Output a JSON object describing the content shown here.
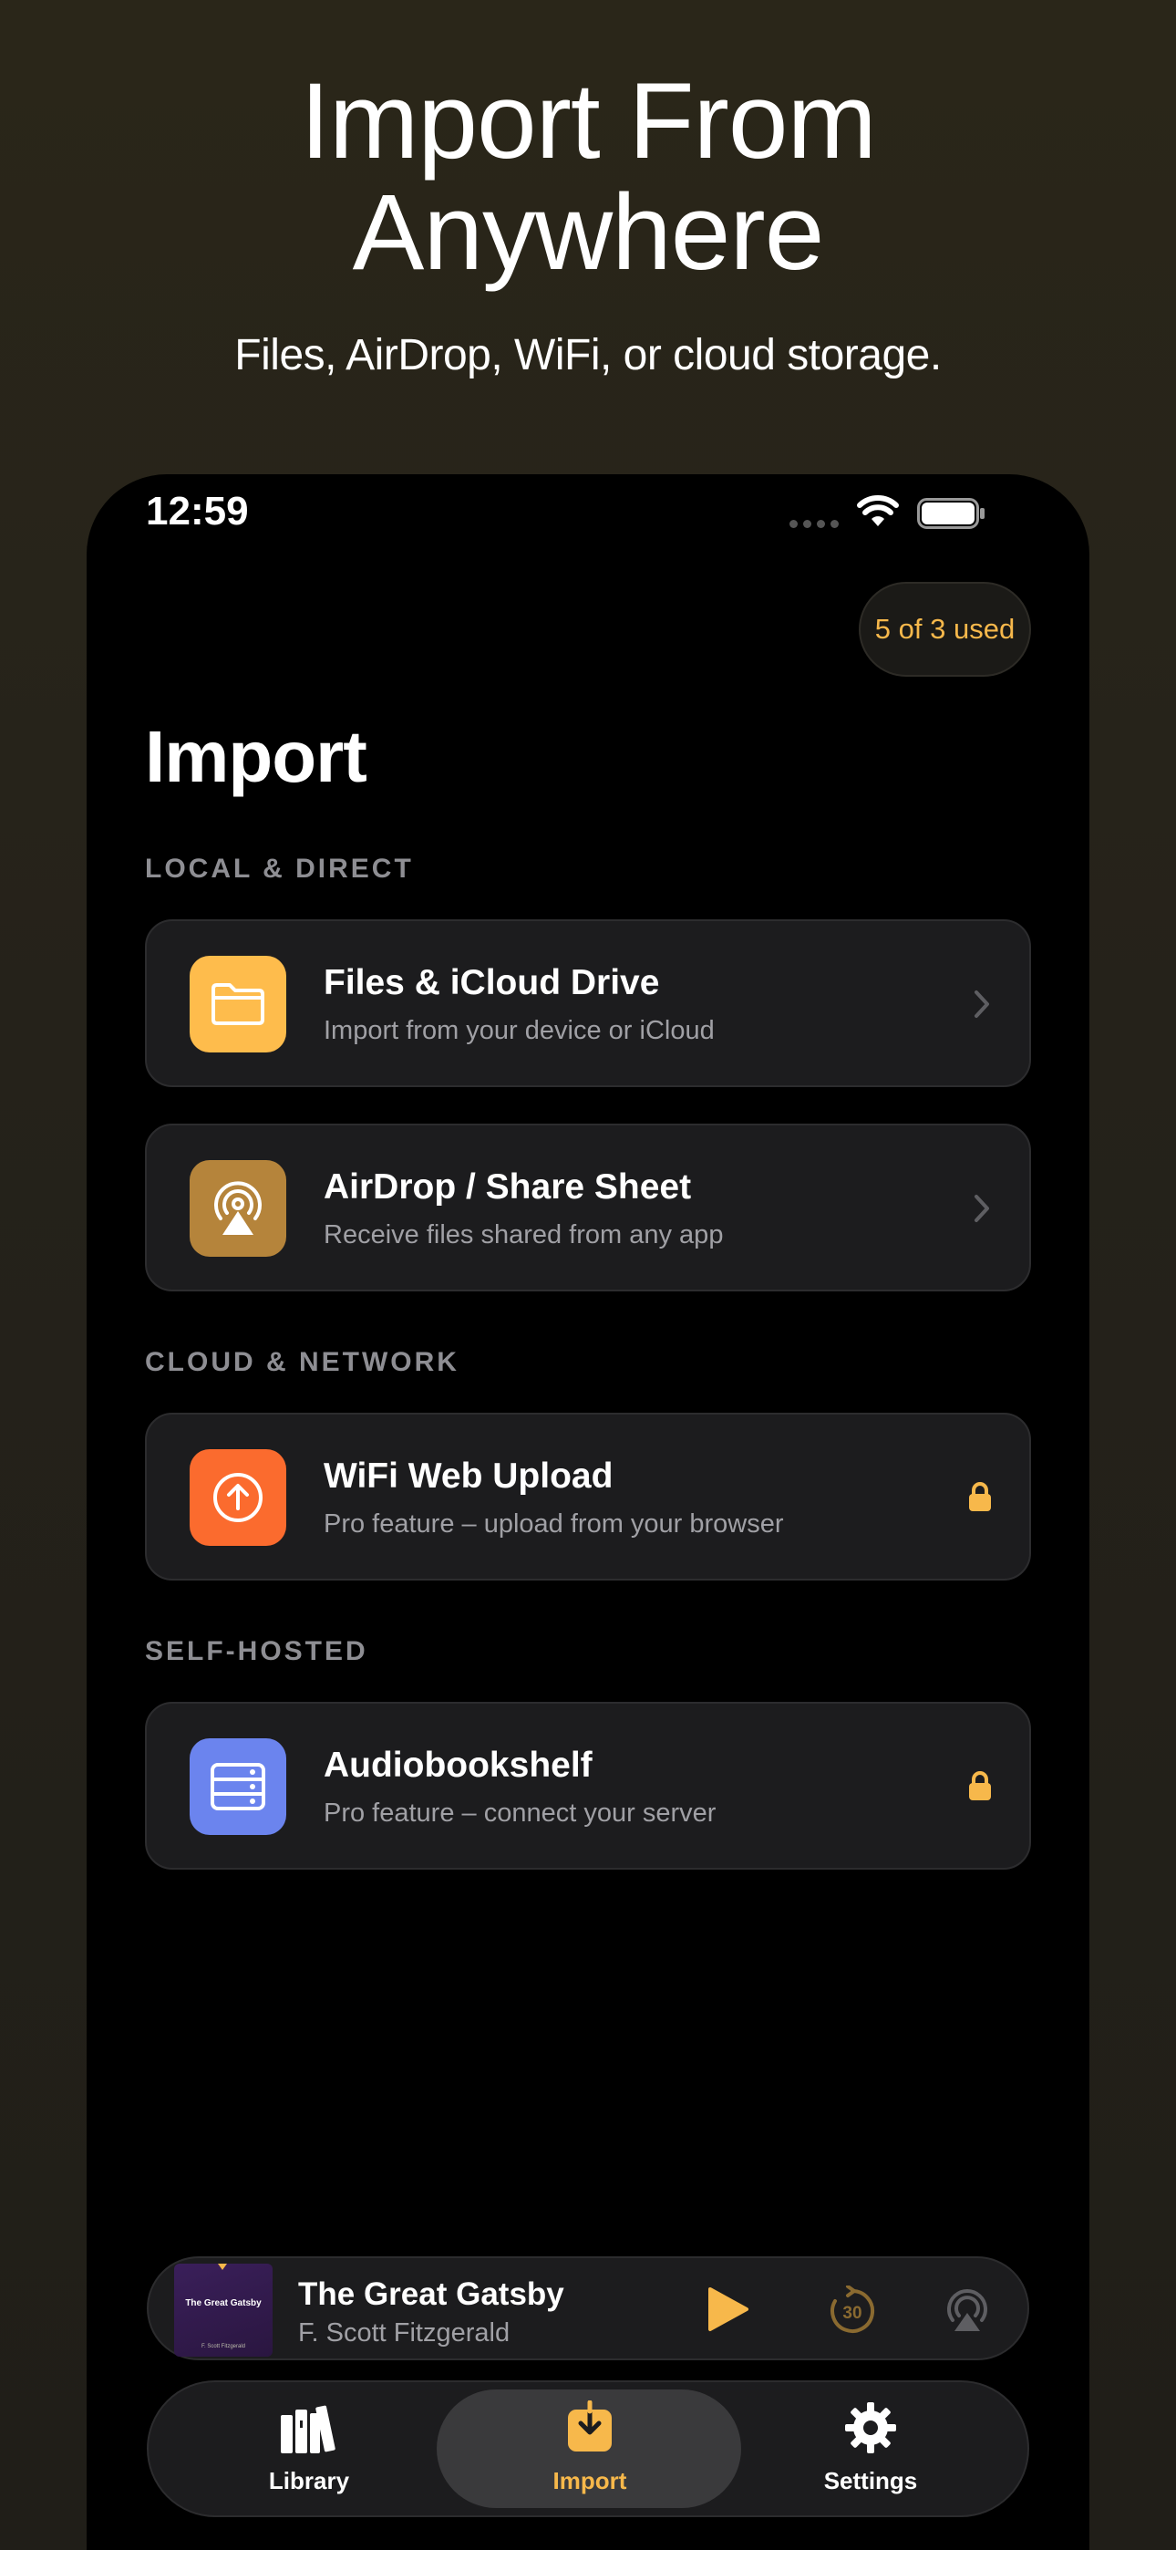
{
  "hero": {
    "title_line1": "Import From",
    "title_line2": "Anywhere",
    "subtitle": "Files, AirDrop, WiFi, or cloud storage."
  },
  "status_bar": {
    "time": "12:59"
  },
  "usage_badge": "5 of 3 used",
  "page_title": "Import",
  "sections": {
    "local": "LOCAL & DIRECT",
    "cloud": "CLOUD & NETWORK",
    "self_hosted": "SELF-HOSTED"
  },
  "sources": [
    {
      "title": "Files & iCloud Drive",
      "subtitle": "Import from your device or iCloud",
      "icon": "folder-icon",
      "trailing": "chevron-right-icon",
      "color": "#febc4c"
    },
    {
      "title": "AirDrop / Share Sheet",
      "subtitle": "Receive files shared from any app",
      "icon": "airdrop-icon",
      "trailing": "chevron-right-icon",
      "color": "#b5843b"
    },
    {
      "title": "WiFi Web Upload",
      "subtitle": "Pro feature – upload from your browser",
      "icon": "upload-icon",
      "trailing": "lock-icon",
      "color": "#fb6b2e"
    },
    {
      "title": "Audiobookshelf",
      "subtitle": "Pro feature – connect your server",
      "icon": "server-icon",
      "trailing": "lock-icon",
      "color": "#6b84ee"
    }
  ],
  "now_playing": {
    "title": "The Great Gatsby",
    "author": "F. Scott Fitzgerald",
    "cover_title": "The Great Gatsby",
    "cover_author": "F. Scott Fitzgerald",
    "skip_label": "30"
  },
  "tabs": [
    {
      "label": "Library",
      "icon": "books-icon",
      "active": false
    },
    {
      "label": "Import",
      "icon": "import-tray-icon",
      "active": true
    },
    {
      "label": "Settings",
      "icon": "gear-icon",
      "active": false
    }
  ],
  "colors": {
    "accent": "#f7b84b",
    "background": "#000000",
    "card": "#1c1c1e"
  }
}
